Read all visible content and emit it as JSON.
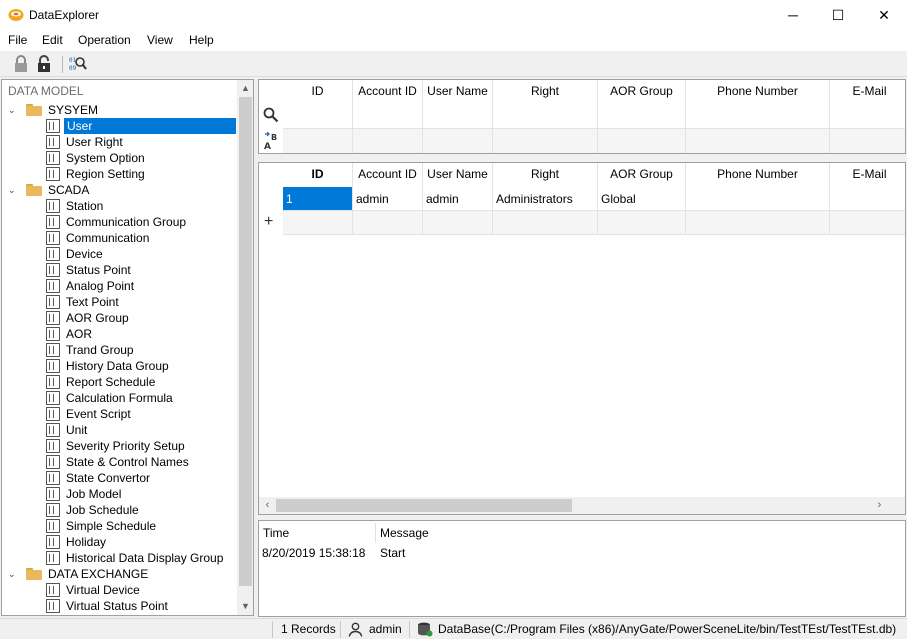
{
  "window": {
    "title": "DataExplorer",
    "minimize_label": "─",
    "maximize_label": "☐",
    "close_label": "✕"
  },
  "menu": {
    "items": [
      "File",
      "Edit",
      "Operation",
      "View",
      "Help"
    ]
  },
  "toolbar": {
    "buttons": [
      "lock-icon",
      "unlock-icon",
      "binary-search-icon"
    ]
  },
  "tree": {
    "header": "DATA MODEL",
    "groups": [
      {
        "label": "SYSYEM",
        "items": [
          "User",
          "User Right",
          "System Option",
          "Region Setting"
        ]
      },
      {
        "label": "SCADA",
        "items": [
          "Station",
          "Communication Group",
          "Communication",
          "Device",
          "Status Point",
          "Analog Point",
          "Text Point",
          "AOR Group",
          "AOR",
          "Trand Group",
          "History Data Group",
          "Report Schedule",
          "Calculation Formula",
          "Event Script",
          "Unit",
          "Severity Priority Setup",
          "State & Control Names",
          "State Convertor",
          "Job Model",
          "Job Schedule",
          "Simple Schedule",
          "Holiday",
          "Historical Data Display Group"
        ]
      },
      {
        "label": "DATA EXCHANGE",
        "items": [
          "Virtual Device",
          "Virtual Status Point"
        ]
      }
    ],
    "selected": "User"
  },
  "filter_grid": {
    "columns": [
      "ID",
      "Account ID",
      "User Name",
      "Right",
      "AOR Group",
      "Phone Number",
      "E-Mail"
    ]
  },
  "data_grid": {
    "columns": [
      "ID",
      "Account ID",
      "User Name",
      "Right",
      "AOR Group",
      "Phone Number",
      "E-Mail"
    ],
    "rows": [
      [
        "1",
        "admin",
        "admin",
        "Administrators",
        "Global",
        "",
        ""
      ]
    ],
    "add_row_label": "+"
  },
  "log": {
    "columns": [
      "Time",
      "Message"
    ],
    "rows": [
      {
        "time": "8/20/2019 15:38:18",
        "message": "Start"
      }
    ]
  },
  "statusbar": {
    "records": "1 Records",
    "user": "admin",
    "database": "DataBase(C:/Program Files (x86)/AnyGate/PowerSceneLite/bin/TestTEst/TestTEst.db)"
  },
  "colors": {
    "selection": "#0078d7",
    "folder": "#e8b85a"
  }
}
